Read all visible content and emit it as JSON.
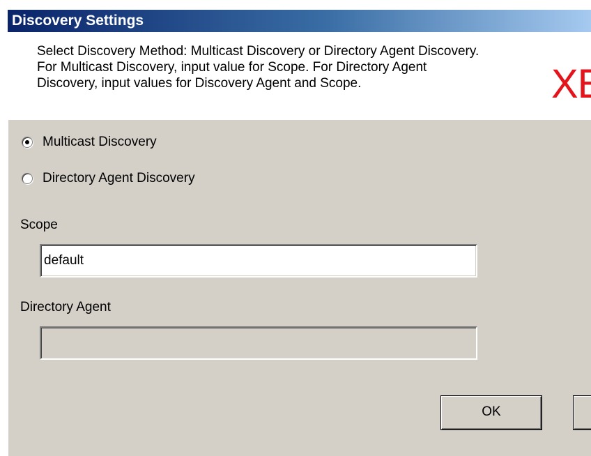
{
  "window": {
    "title": "Discovery Settings"
  },
  "header": {
    "instructions": "Select Discovery Method: Multicast Discovery or Directory Agent Discovery. For Multicast Discovery, input value for Scope. For Directory Agent Discovery, input values for Discovery Agent and Scope.",
    "instruction_lines": [
      "Select Discovery Method: Multicast Discovery or Directory Agent Discovery.",
      "For Multicast Discovery, input value for Scope. For Directory Agent",
      "Discovery, input values for Discovery Agent and Scope."
    ],
    "logo_text": "XE",
    "logo_color": "#e3141b"
  },
  "discovery_method": {
    "options": [
      {
        "label": "Multicast Discovery",
        "selected": true
      },
      {
        "label": "Directory Agent Discovery",
        "selected": false
      }
    ]
  },
  "scope": {
    "label": "Scope",
    "value": "default"
  },
  "directory_agent": {
    "label": "Directory Agent",
    "value": "",
    "enabled": false
  },
  "buttons": {
    "ok_label": "OK",
    "cancel_label": ""
  },
  "colors": {
    "dialog_bg": "#d4d0c8",
    "title_gradient_start": "#0a246a",
    "title_gradient_end": "#a6caf0"
  }
}
